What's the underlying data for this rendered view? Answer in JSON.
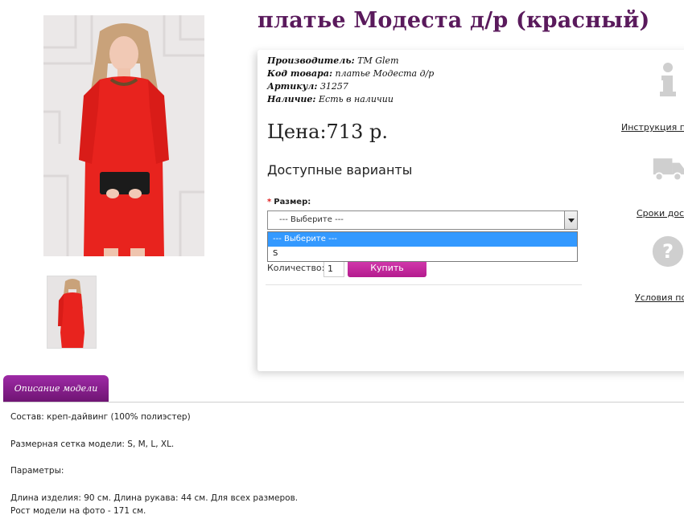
{
  "product": {
    "title": "платье Модеста д/р (красный)"
  },
  "meta": {
    "manufacturer_label": "Производитель:",
    "manufacturer_value": "ТМ Glem",
    "code_label": "Код товара:",
    "code_value": "платье Модеста д/р",
    "article_label": "Артикул:",
    "article_value": "31257",
    "stock_label": "Наличие:",
    "stock_value": "Есть в наличии"
  },
  "price": "Цена:713 р.",
  "variants": {
    "title": "Доступные варианты",
    "size_label": "Размер:",
    "required_mark": "*",
    "selected": "--- Выберите ---",
    "options": [
      "--- Выберите ---",
      "S"
    ]
  },
  "purchase": {
    "qty_label": "Количество:",
    "qty_value": "1",
    "buy_label": "Купить"
  },
  "side_links": {
    "instructions": "Инструкция по",
    "delivery": "Сроки дост",
    "terms": "Условия по"
  },
  "tabs": {
    "description": "Описание модели"
  },
  "description": {
    "composition": "Состав: креп-дайвинг (100% полиэстер)",
    "size_grid": "Размерная сетка модели: S, M, L, XL.",
    "params_title": "Параметры:",
    "length": "Длина изделия: 90 см. Длина рукава: 44 см. Для всех размеров.",
    "model_height": "Рост модели на фото - 171 см."
  },
  "colors": {
    "title": "#5a1a5c",
    "buy_button": "#c22b9e",
    "tab": "#8a1e90",
    "dress": "#e8231e",
    "select_highlight": "#3399ff"
  },
  "icons": [
    "info-icon",
    "truck-icon",
    "question-icon",
    "dropdown-arrow-icon"
  ]
}
